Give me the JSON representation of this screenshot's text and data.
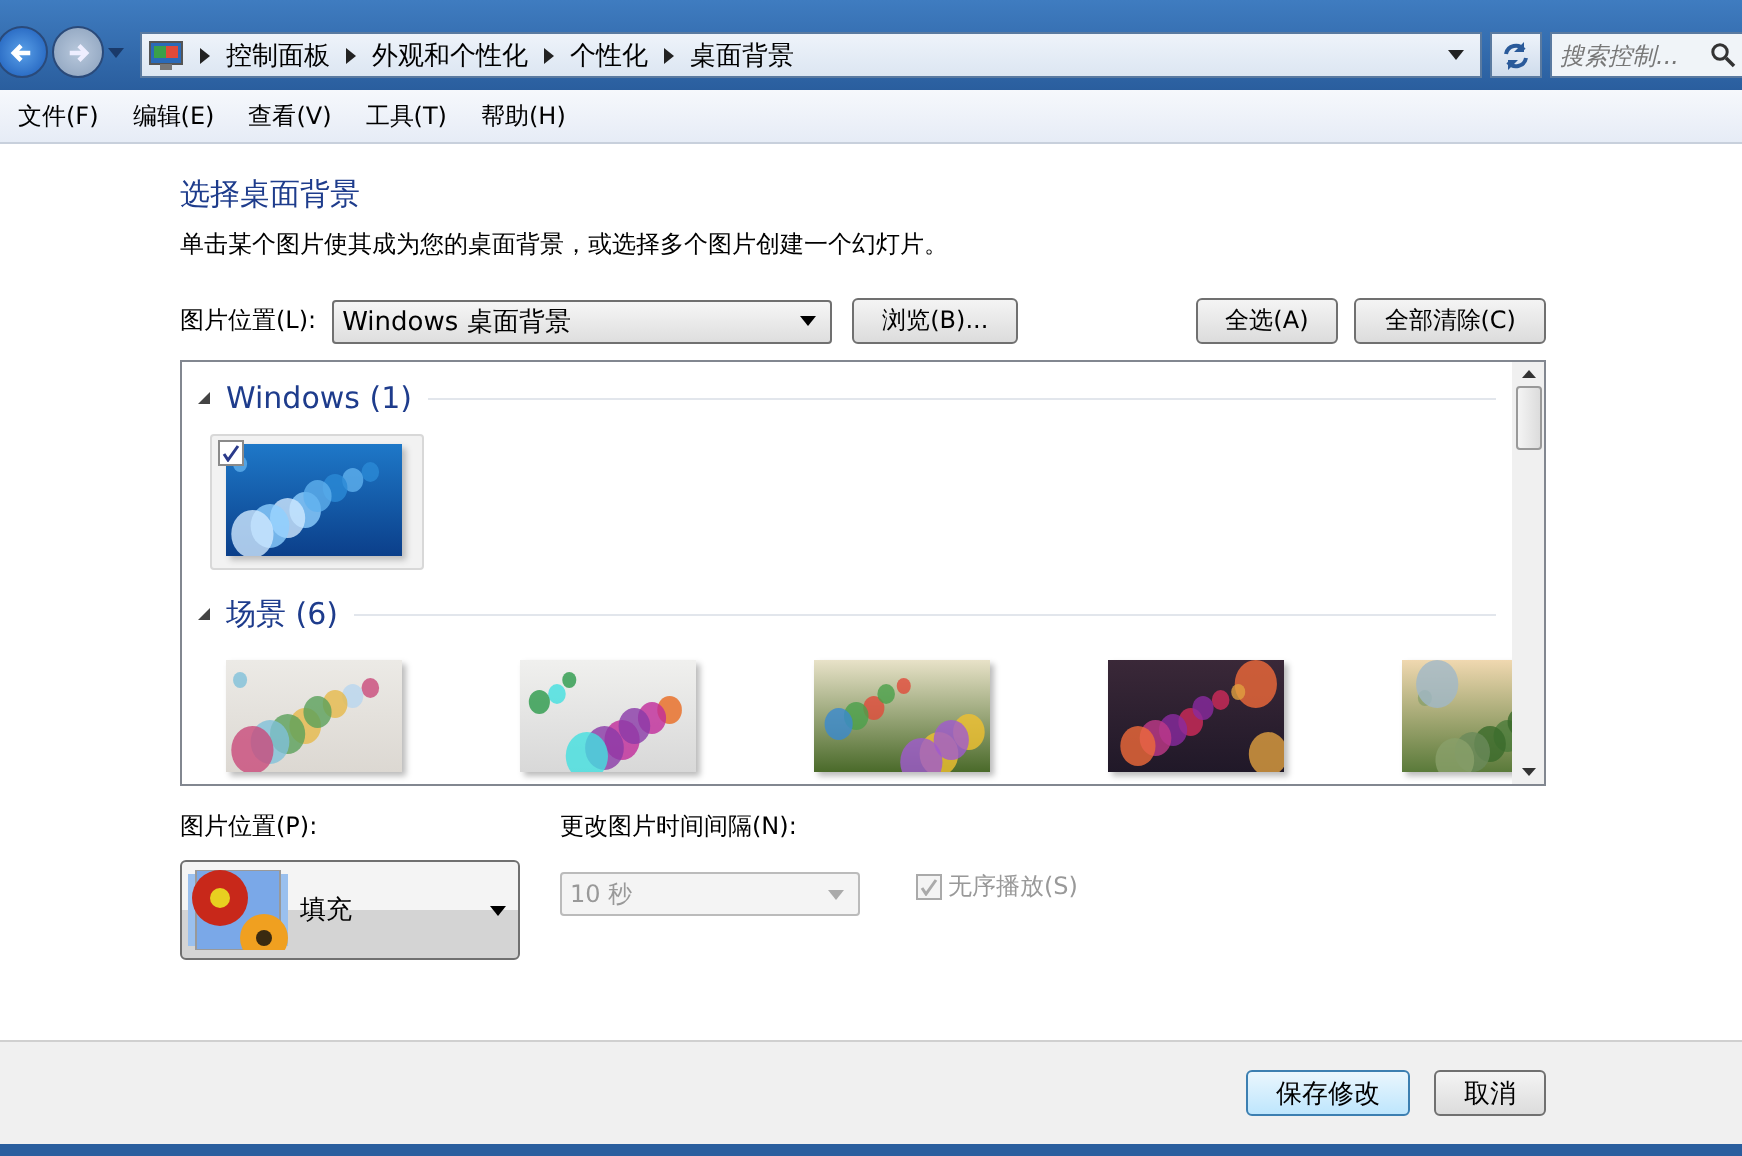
{
  "address_bar": {
    "breadcrumbs": [
      "控制面板",
      "外观和个性化",
      "个性化",
      "桌面背景"
    ]
  },
  "search": {
    "placeholder": "搜索控制..."
  },
  "menu": [
    "文件(F)",
    "编辑(E)",
    "查看(V)",
    "工具(T)",
    "帮助(H)"
  ],
  "heading": "选择桌面背景",
  "description": "单击某个图片使其成为您的桌面背景，或选择多个图片创建一个幻灯片。",
  "location": {
    "label": "图片位置(L):",
    "value": "Windows 桌面背景",
    "browse": "浏览(B)...",
    "select_all": "全选(A)",
    "clear_all": "全部清除(C)"
  },
  "groups": [
    {
      "title": "Windows (1)",
      "expanded": true,
      "items": [
        {
          "checked": true
        }
      ]
    },
    {
      "title": "场景 (6)",
      "expanded": true,
      "items": [
        {
          "checked": false
        },
        {
          "checked": false
        },
        {
          "checked": false
        },
        {
          "checked": false
        },
        {
          "checked": false
        }
      ]
    }
  ],
  "position": {
    "label": "图片位置(P):",
    "value": "填充"
  },
  "interval": {
    "label": "更改图片时间间隔(N):",
    "value": "10 秒",
    "disabled": true
  },
  "shuffle": {
    "label": "无序播放(S)",
    "checked": true,
    "disabled": true
  },
  "buttons": [
    "保存修改",
    "取消"
  ]
}
